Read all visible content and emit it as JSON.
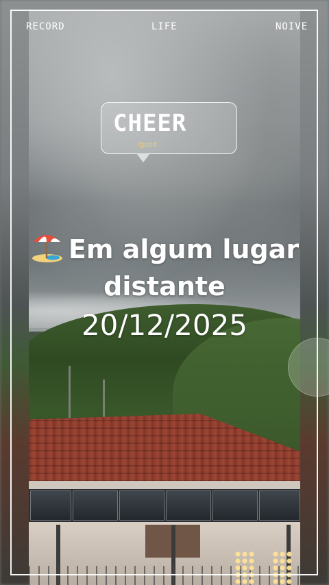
{
  "top_bar": {
    "left_label": "RECORD",
    "center_label": "LIFE",
    "right_label": "NOIVE"
  },
  "bubble": {
    "title": "CHEER",
    "subtitle": "good"
  },
  "headline": {
    "emoji_icon": "beach-umbrella-icon",
    "line1": "Em algum lugar",
    "line2": "distante"
  },
  "date_text": "20/12/2025",
  "colors": {
    "frame": "#ffffff",
    "bubble_sub": "#f1d36b",
    "roof": "#93402f",
    "hill": "#3f5d2e"
  }
}
